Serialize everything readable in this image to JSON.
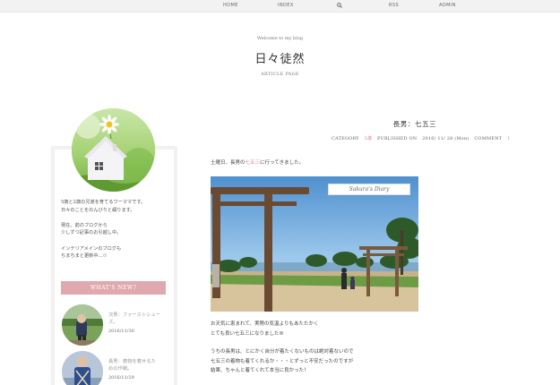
{
  "nav": {
    "home": "HOME",
    "index": "INDEX",
    "rss": "RSS",
    "admin": "ADMIN",
    "search_icon": "search-icon"
  },
  "header": {
    "welcome": "Welcome to my blog",
    "title": "日々徒然",
    "page_type": "ARTICLE PAGE"
  },
  "sidebar": {
    "profile_lines": [
      "5歳と2歳の兄弟を育てるワーママです。",
      "日々のことをのんびりと綴ります。",
      "",
      "現在、前のブログから",
      "少しずつ記事のお引越し中。",
      "",
      "インテリアメインのブログも",
      "ちまちまと更新中…"
    ],
    "whats_new": "WHAT'S NEW?",
    "news": [
      {
        "title_lines": [
          "次男：ファーストシュー",
          "ズ。"
        ],
        "date": "2016/11/30"
      },
      {
        "title_lines": [
          "長男：着物を着せるた",
          "めの作戦。"
        ],
        "date": "2016/11/29"
      }
    ]
  },
  "article": {
    "title": "長男：七五三",
    "meta": {
      "category_label": "CATEGORY",
      "category": "5歳",
      "published_label": "PUBLISHED ON",
      "date": "2016/ 11/ 28 (Mon)",
      "comment_label": "COMMENT",
      "comment_count": "1"
    },
    "intro": {
      "before": "土曜日、長男の",
      "link": "七五三",
      "after": "に行ってきました。"
    },
    "photo_tag": "Sakura's Diary",
    "para1": [
      "お天気に恵まれて、実際の気温よりもあたたかく",
      "とても良い七五三になりました☺"
    ],
    "para2": [
      "うちの長男は、とにかく自分が着たくないものは絶対着ないので",
      "七五三の着物も着てくれるか・・・とずっと不安だったのですが",
      "結果、ちゃんと着てくれて本当に良かった！"
    ]
  },
  "colors": {
    "accent_pink": "#e0a9ae",
    "link_pink": "#d48a92",
    "nav_bg": "#f2f2f2"
  }
}
